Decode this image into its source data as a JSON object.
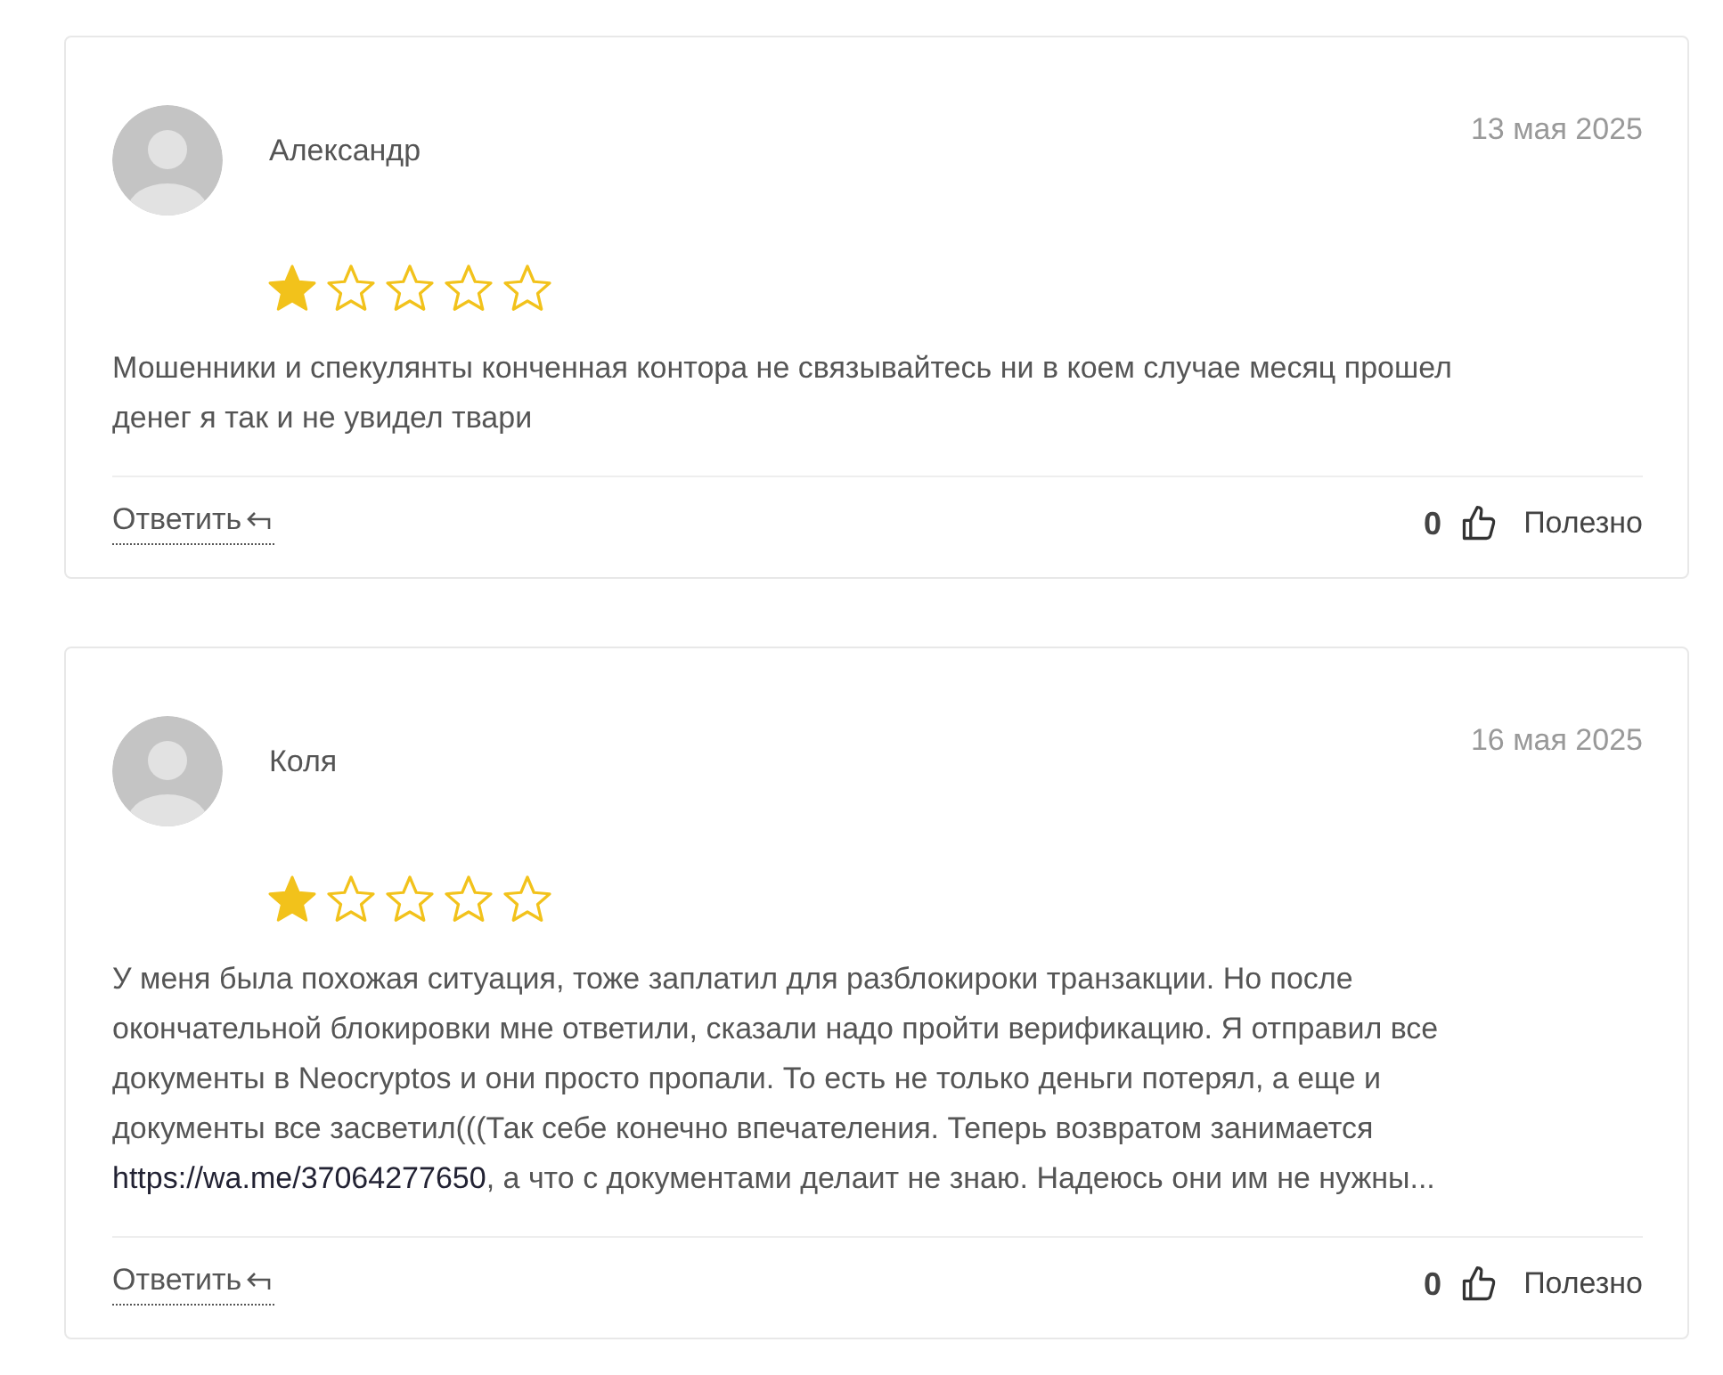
{
  "reviews": [
    {
      "author": "Александр",
      "date": "13 мая 2025",
      "stars": 1,
      "body": [
        {
          "kind": "text",
          "text": "Мошенники и спекулянты конченная контора не связывайтесь ни в коем случае месяц прошел денег я так и не увидел твари"
        }
      ],
      "reply": "Ответить",
      "likes": "0",
      "useful": "Полезно"
    },
    {
      "author": "Коля",
      "date": "16 мая 2025",
      "stars": 1,
      "body": [
        {
          "kind": "text",
          "text": "У меня была похожая ситуация, тоже заплатил для разблокироки транзакции. Но после окончательной блокировки мне ответили, сказали надо пройти верификацию. Я отправил все документы в Neocryptos и они просто пропали. То есть не только деньги потерял, а еще и документы все засветил(((Так себе конечно впечателения. Теперь возвратом занимается "
        },
        {
          "kind": "link",
          "text": "https://wa.me/37064277650"
        },
        {
          "kind": "text",
          "text": ", а что с документами делаит не знаю. Надеюсь они им не нужны..."
        }
      ],
      "reply": "Ответить",
      "likes": "0",
      "useful": "Полезно"
    }
  ]
}
